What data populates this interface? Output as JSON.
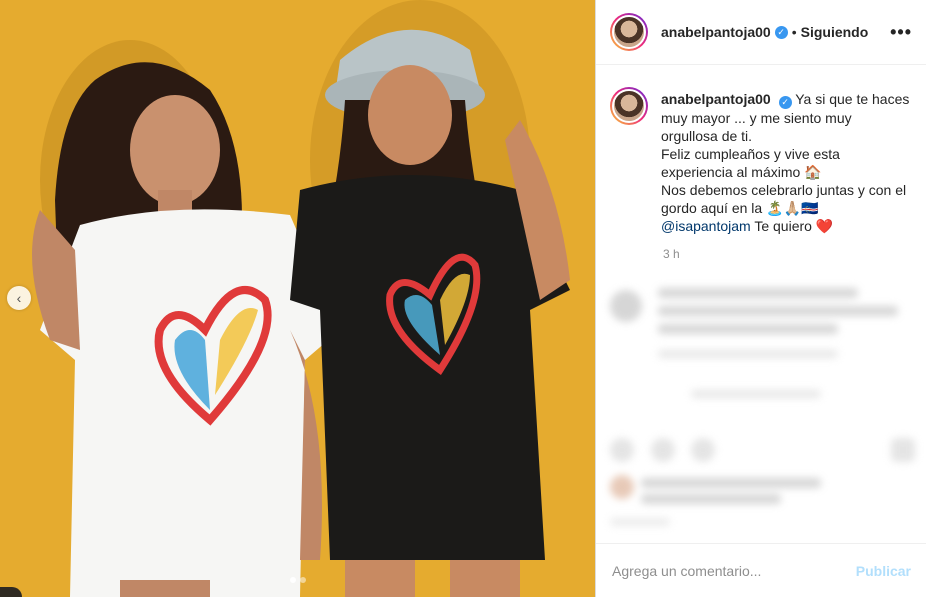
{
  "post": {
    "username": "anabelpantoja00",
    "verified_icon": "verified-badge-icon",
    "separator": "•",
    "follow_state": "Siguiendo",
    "more_label": "•••",
    "caption_lines": "Ya si que te haces muy mayor ... y me siento muy orgullosa de ti.\nFeliz cumpleaños y vive esta experiencia al máximo 🏠\nNos debemos celebrarlo juntas y con el gordo aquí en la 🏝️🙏🏼🇨🇻",
    "mention": "@isapantojam",
    "caption_end": "Te quiero ❤️",
    "time": "3 h",
    "comment_placeholder": "Agrega un comentario...",
    "publish_label": "Publicar"
  },
  "carousel": {
    "prev_icon": "‹",
    "dots": 2,
    "active_dot": 0
  },
  "colors": {
    "accent": "#3897f0",
    "publish_disabled": "#b2dffc",
    "wall": "#e3a62a"
  }
}
